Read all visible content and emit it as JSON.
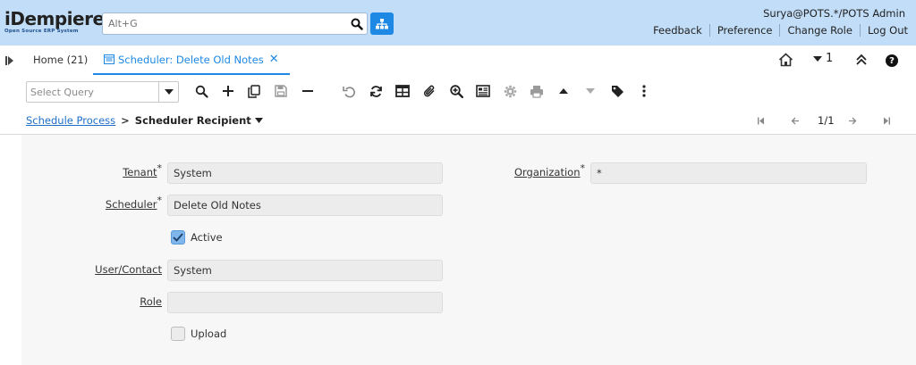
{
  "header": {
    "logo_main": "iDempiere",
    "logo_sub": "Open Source ERP System",
    "search_placeholder": "Alt+G",
    "user": "Surya@POTS.*/POTS Admin",
    "links": [
      "Feedback",
      "Preference",
      "Change Role",
      "Log Out"
    ]
  },
  "tabs": {
    "home": "Home (21)",
    "active": "Scheduler: Delete Old Notes",
    "close_glyph": "✕",
    "window_count": "1"
  },
  "toolbar": {
    "query_placeholder": "Select Query",
    "icons": [
      "search-icon",
      "new-record-icon",
      "copy-icon",
      "save-icon",
      "delete-icon",
      "undo-icon",
      "refresh-icon",
      "grid-toggle-icon",
      "attachment-icon",
      "zoom-across-icon",
      "report-icon",
      "process-gear-icon",
      "print-icon",
      "parent-record-icon",
      "detail-record-icon",
      "tag-icon",
      "more-icon"
    ]
  },
  "breadcrumb": {
    "parent": "Schedule Process",
    "separator": ">",
    "current": "Scheduler Recipient",
    "record": "1/1"
  },
  "form": {
    "tenant": {
      "label": "Tenant",
      "value": "System",
      "required": "*"
    },
    "organization": {
      "label": "Organization",
      "value": "*",
      "required": "*"
    },
    "scheduler": {
      "label": "Scheduler",
      "value": "Delete Old Notes",
      "required": "*"
    },
    "active": {
      "label": "Active",
      "checked": true
    },
    "user_contact": {
      "label": "User/Contact",
      "value": "System"
    },
    "role": {
      "label": "Role",
      "value": ""
    },
    "upload": {
      "label": "Upload",
      "checked": false
    }
  },
  "colors": {
    "header_bg": "#c2ddf7",
    "accent": "#1e88e5",
    "link": "#1e6fc8",
    "form_bg": "#f7f7f7",
    "field_bg": "#ececec"
  }
}
